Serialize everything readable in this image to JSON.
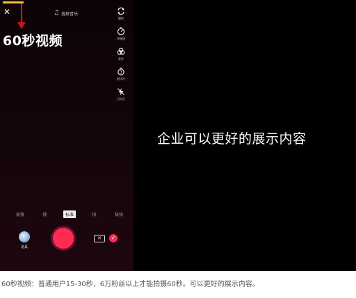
{
  "colors": {
    "accent": "#fe2c55",
    "progress": "#f2c230",
    "arrow": "#c4161c"
  },
  "header": {
    "close_icon": "close-icon",
    "music_label": "选择音乐",
    "music_icon": "music-note-icon"
  },
  "overlay_title": "60秒视频",
  "tools": [
    {
      "icon": "flip-camera-icon",
      "label": "翻转"
    },
    {
      "icon": "speed-icon",
      "label": "快慢速"
    },
    {
      "icon": "beauty-icon",
      "label": "美化"
    },
    {
      "icon": "timer-icon",
      "label": "倒计时"
    },
    {
      "icon": "flash-icon",
      "label": "闪光灯"
    }
  ],
  "speeds": [
    {
      "label": "极慢",
      "active": false
    },
    {
      "label": "慢",
      "active": false
    },
    {
      "label": "标准",
      "active": true
    },
    {
      "label": "快",
      "active": false
    },
    {
      "label": "极快",
      "active": false
    }
  ],
  "bottom": {
    "effects_label": "道具"
  },
  "promo_text": "企业可以更好的展示内容",
  "caption": "60秒视频：普通用户15-30秒，6万粉丝以上才能拍摄60秒。可以更好的展示内容。"
}
